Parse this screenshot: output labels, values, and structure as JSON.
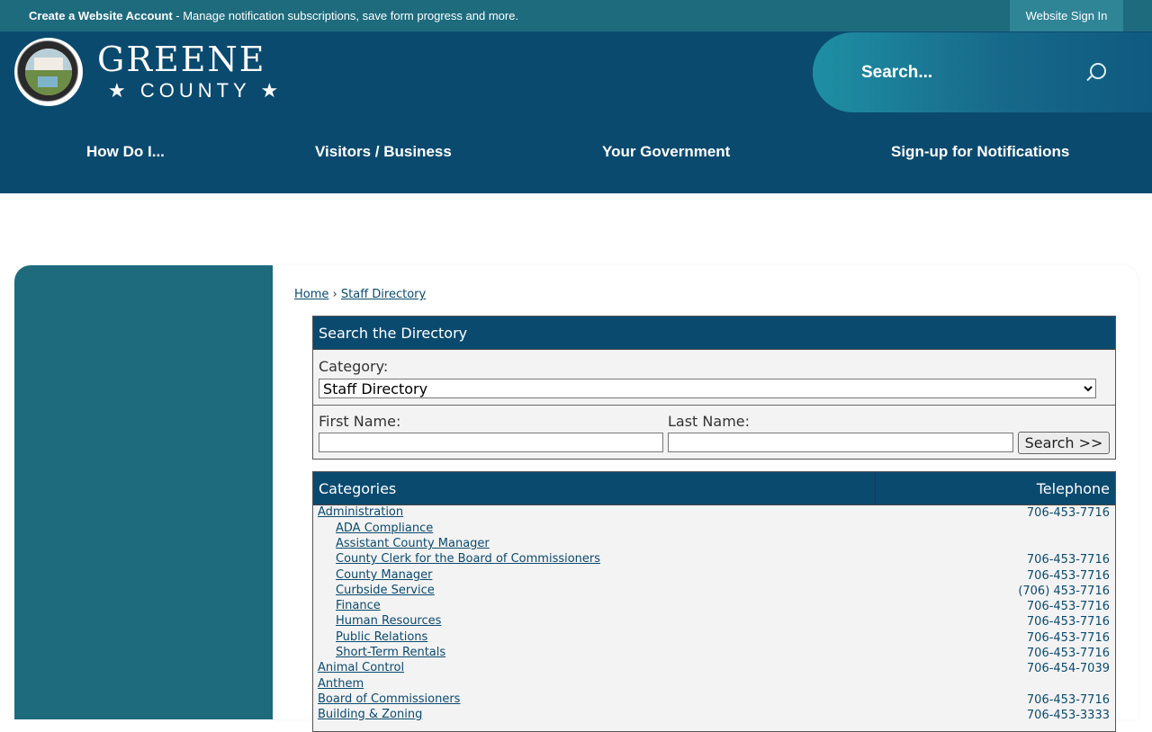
{
  "topbar": {
    "create_account": "Create a Website Account",
    "message": " - Manage notification subscriptions, save form progress and more.",
    "sign_in": "Website Sign In"
  },
  "header": {
    "logo_name": "GREENE",
    "logo_sub": "★ COUNTY ★",
    "search_placeholder": "Search...",
    "nav": [
      "How Do I...",
      "Visitors / Business",
      "Your Government",
      "Sign-up for Notifications"
    ]
  },
  "breadcrumb": {
    "home": "Home",
    "current": "Staff Directory"
  },
  "search_panel": {
    "title": "Search the Directory",
    "category_label": "Category:",
    "category_value": "Staff Directory",
    "first_name_label": "First Name:",
    "last_name_label": "Last Name:",
    "search_button": "Search >>"
  },
  "directory": {
    "col_categories": "Categories",
    "col_telephone": "Telephone",
    "rows": [
      {
        "name": "Administration",
        "tel": "706-453-7716"
      },
      {
        "name": "ADA Compliance",
        "tel": ""
      },
      {
        "name": "Assistant County Manager",
        "tel": ""
      },
      {
        "name": "County Clerk for the Board of Commissioners",
        "tel": "706-453-7716"
      },
      {
        "name": "County Manager",
        "tel": "706-453-7716"
      },
      {
        "name": "Curbside Service",
        "tel": "(706) 453-7716"
      },
      {
        "name": "Finance",
        "tel": "706-453-7716"
      },
      {
        "name": "Human Resources",
        "tel": "706-453-7716"
      },
      {
        "name": "Public Relations",
        "tel": "706-453-7716"
      },
      {
        "name": "Short-Term Rentals",
        "tel": "706-453-7716"
      },
      {
        "name": "Animal Control",
        "tel": "706-454-7039"
      },
      {
        "name": "Anthem",
        "tel": ""
      },
      {
        "name": "Board of Commissioners",
        "tel": "706-453-7716"
      },
      {
        "name": "Building & Zoning",
        "tel": "706-453-3333"
      }
    ]
  },
  "colors": {
    "brand_navy": "#0b4a6f",
    "brand_teal": "#1e6b7d"
  }
}
